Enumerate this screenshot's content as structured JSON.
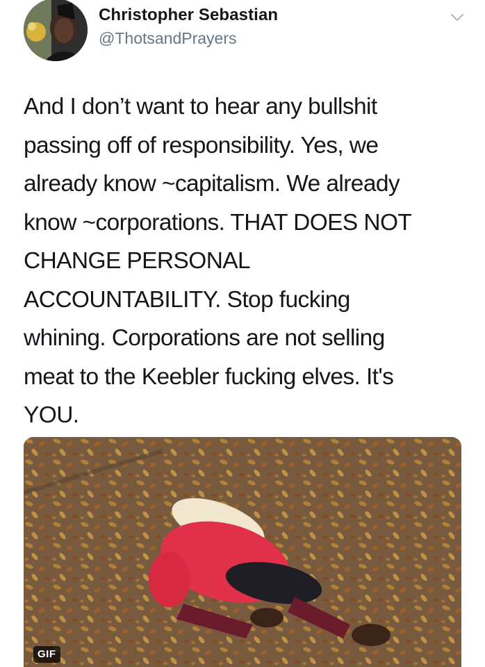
{
  "tweet": {
    "author_name": "Christopher Sebastian",
    "author_handle": "@ThotsandPrayers",
    "menu_icon": "chevron-down-icon",
    "text": "And I don’t want to hear any bullshit\npassing off of responsibility. Yes, we\nalready know ~capitalism. We already\nknow ~corporations. THAT DOES NOT\nCHANGE PERSONAL\nACCOUNTABILITY. Stop fucking\nwhining. Corporations are not selling\nmeat to the Keebler fucking elves. It's\nYOU.",
    "media": {
      "badge": "GIF"
    }
  },
  "colors": {
    "name": "#14171a",
    "handle": "#657786",
    "chevron": "#aab8c2"
  }
}
